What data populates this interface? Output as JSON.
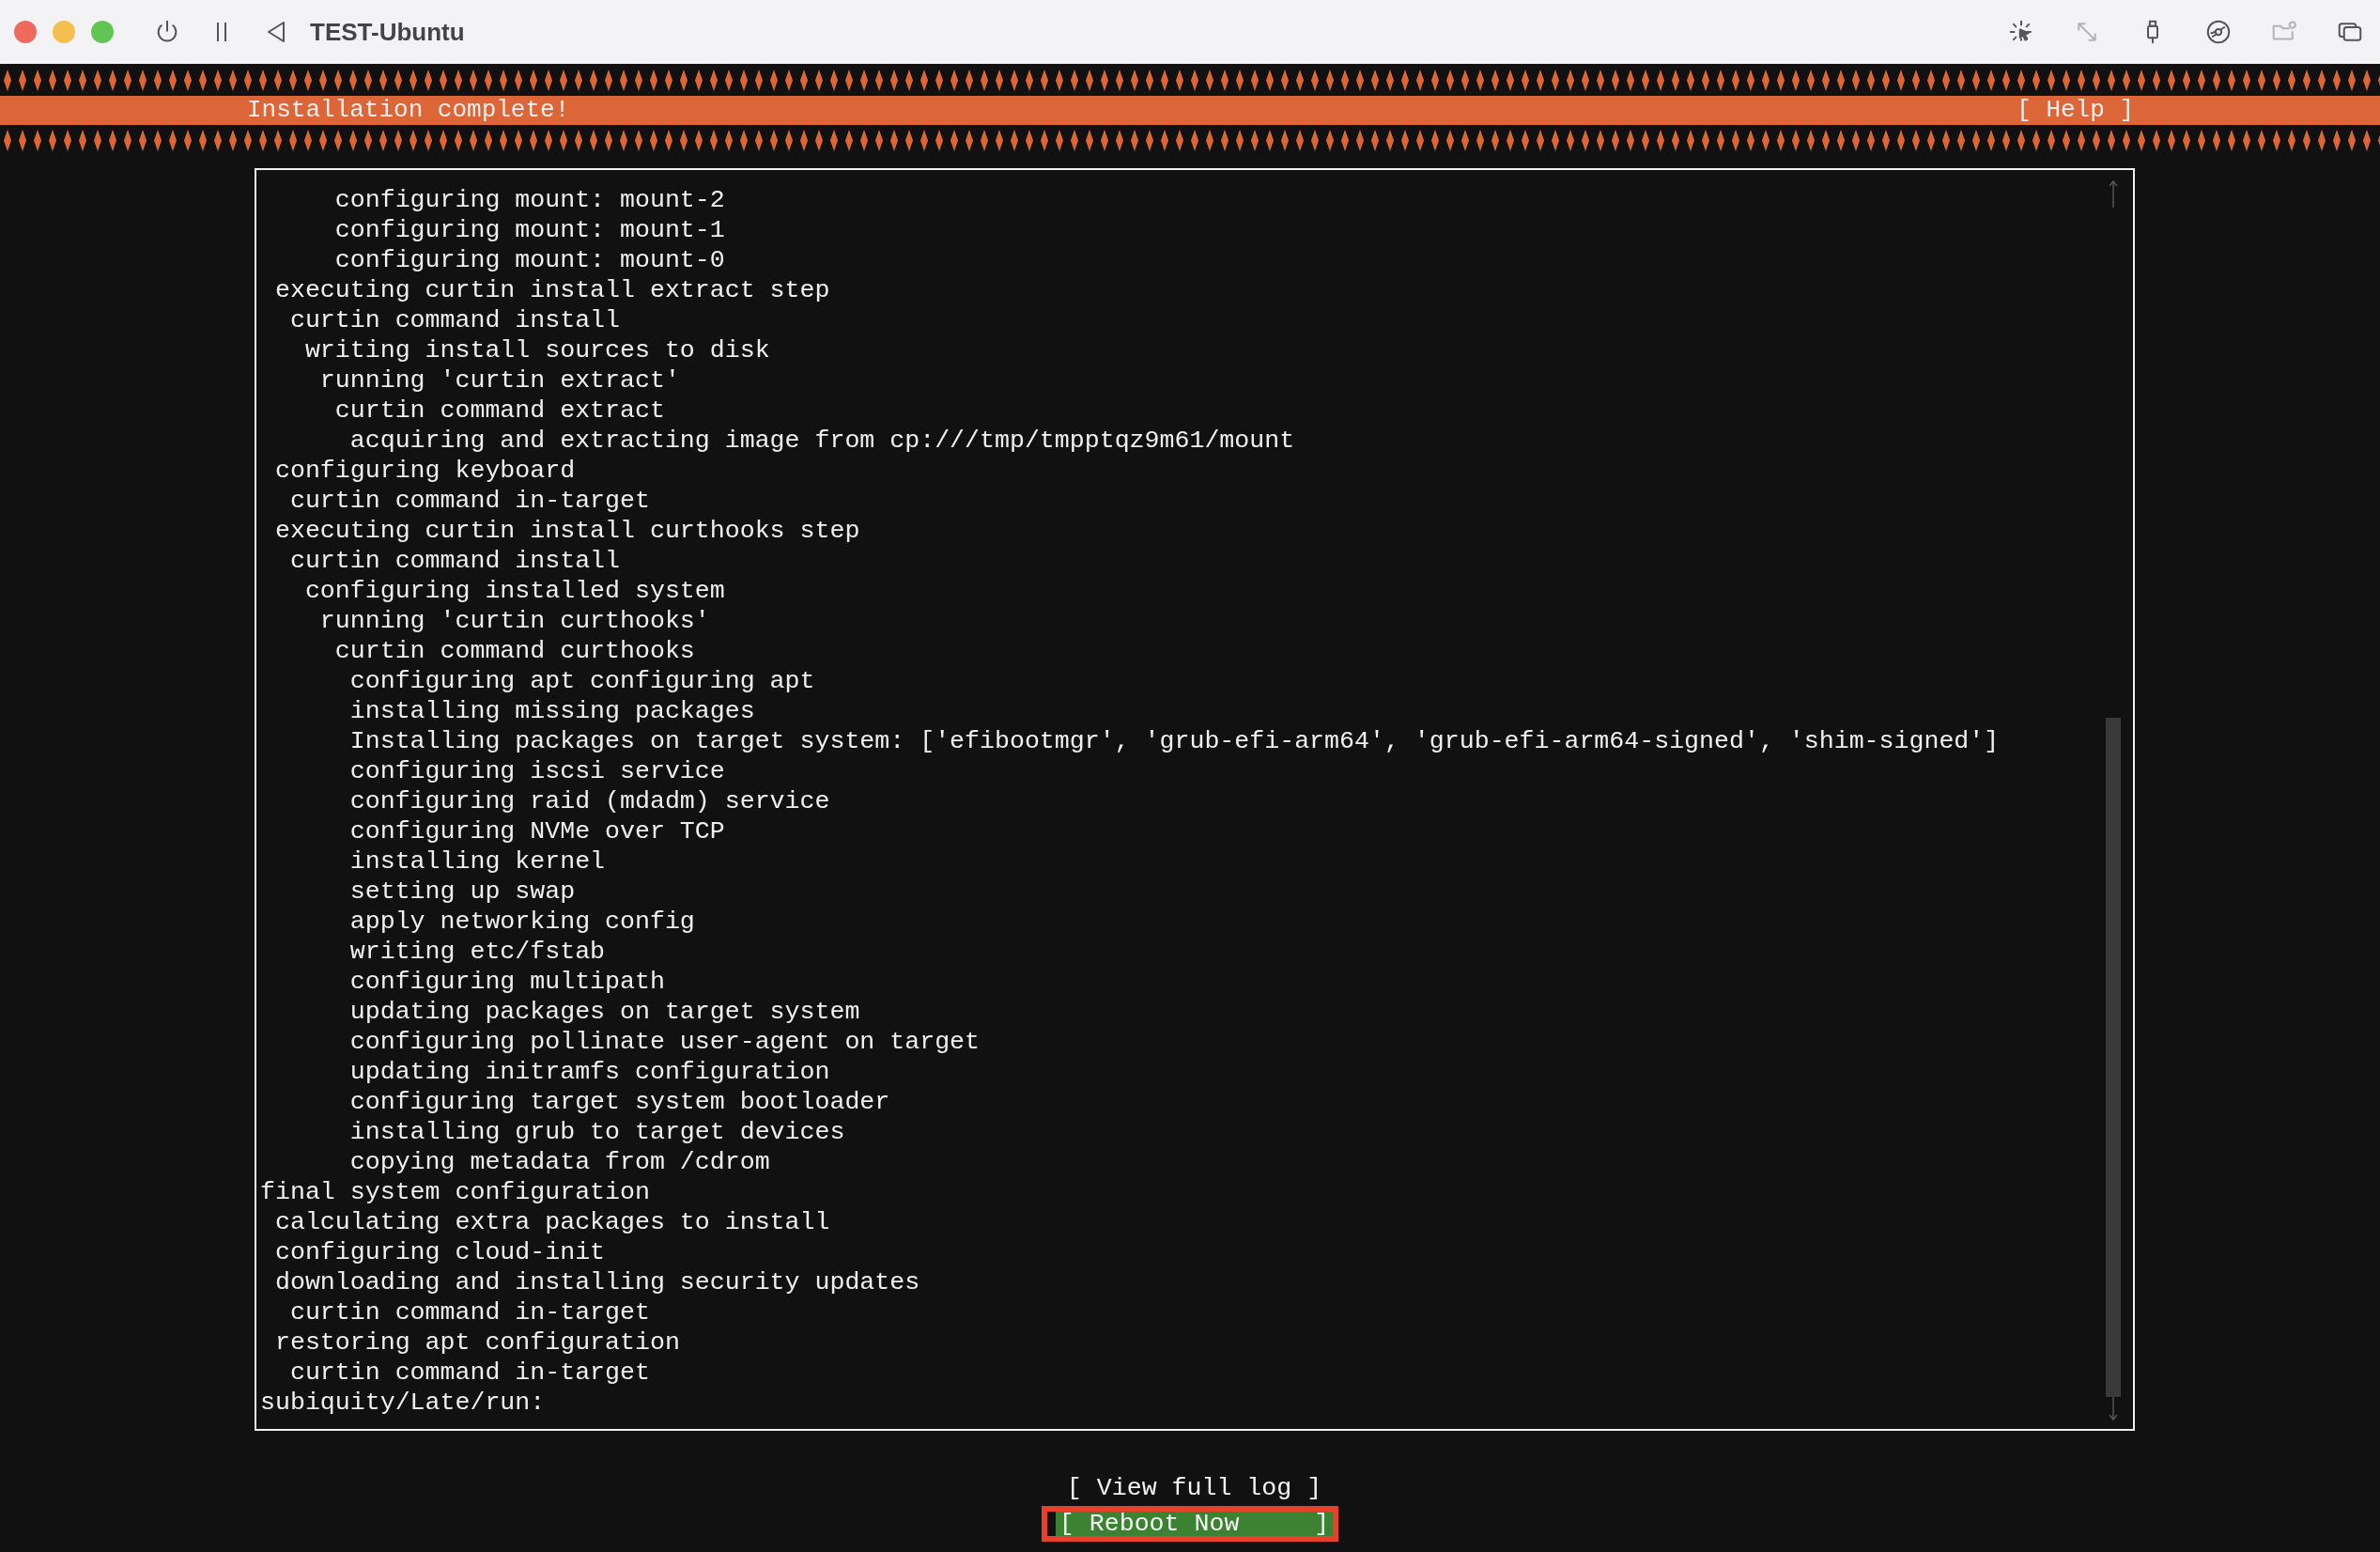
{
  "window": {
    "title": "TEST-Ubuntu"
  },
  "toolbar_icons": [
    {
      "kind": "pointer",
      "disabled": false
    },
    {
      "kind": "resize",
      "disabled": true
    },
    {
      "kind": "usb",
      "disabled": false
    },
    {
      "kind": "disc",
      "disabled": false
    },
    {
      "kind": "shared-folder",
      "disabled": true
    },
    {
      "kind": "windows",
      "disabled": false
    }
  ],
  "header": {
    "title": "Installation complete!",
    "help": "[ Help ]"
  },
  "log_lines": [
    "     configuring mount: mount-2",
    "     configuring mount: mount-1",
    "     configuring mount: mount-0",
    " executing curtin install extract step",
    "  curtin command install",
    "   writing install sources to disk",
    "    running 'curtin extract'",
    "     curtin command extract",
    "      acquiring and extracting image from cp:///tmp/tmpptqz9m61/mount",
    " configuring keyboard",
    "  curtin command in-target",
    " executing curtin install curthooks step",
    "  curtin command install",
    "   configuring installed system",
    "    running 'curtin curthooks'",
    "     curtin command curthooks",
    "      configuring apt configuring apt",
    "      installing missing packages",
    "      Installing packages on target system: ['efibootmgr', 'grub-efi-arm64', 'grub-efi-arm64-signed', 'shim-signed']",
    "      configuring iscsi service",
    "      configuring raid (mdadm) service",
    "      configuring NVMe over TCP",
    "      installing kernel",
    "      setting up swap",
    "      apply networking config",
    "      writing etc/fstab",
    "      configuring multipath",
    "      updating packages on target system",
    "      configuring pollinate user-agent on target",
    "      updating initramfs configuration",
    "      configuring target system bootloader",
    "      installing grub to target devices",
    "      copying metadata from /cdrom",
    "final system configuration",
    " calculating extra packages to install",
    " configuring cloud-init",
    " downloading and installing security updates",
    "  curtin command in-target",
    " restoring apt configuration",
    "  curtin command in-target",
    "subiquity/Late/run: "
  ],
  "buttons": [
    {
      "label": "[ View full log ]",
      "selected": false
    },
    {
      "label": "[ Reboot Now     ]",
      "selected": true
    }
  ]
}
